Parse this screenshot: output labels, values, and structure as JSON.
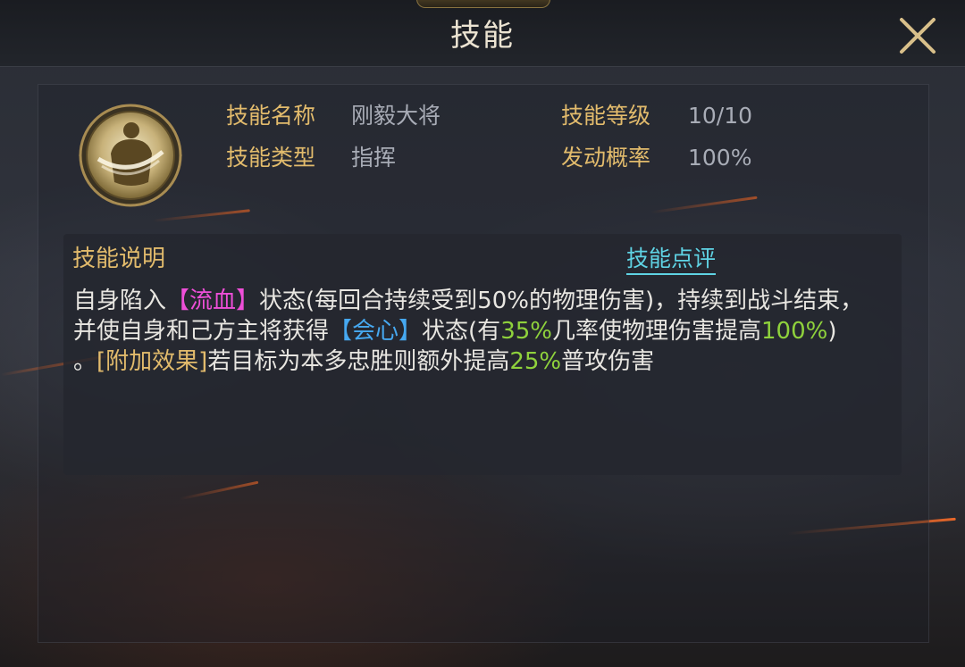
{
  "window": {
    "title": "技能",
    "close_icon": "close-x-icon"
  },
  "skill": {
    "icon": "warrior-emblem-icon",
    "name_label": "技能名称",
    "name_value": "刚毅大将",
    "type_label": "技能类型",
    "type_value": "指挥",
    "level_label": "技能等级",
    "level_value": "10/10",
    "rate_label": "发动概率",
    "rate_value": "100%"
  },
  "description": {
    "title": "技能说明",
    "review_link": "技能点评",
    "text_1a": "自身陷入",
    "bleed": "【流血】",
    "text_1b": "状态(每回合持续受到50%的物理伤害)，持续到战斗结束，并使自身和己方主将获得",
    "crit": "【会心】",
    "text_1c": "状态(有",
    "pct_35": "35%",
    "text_1d": "几率使物理伤害提高",
    "pct_100": "100%",
    "text_1e": ")",
    "text_2a": "。",
    "extra": "[附加效果]",
    "text_2b": "若目标为本多忠胜则额外提高",
    "pct_25": "25%",
    "text_2c": "普攻伤害"
  },
  "colors": {
    "gold_label": "#e2bb6c",
    "bleed_status": "#ee4fd8",
    "crit_status": "#46a8f0",
    "number_highlight": "#8fd23c",
    "link": "#5fd3e4"
  }
}
